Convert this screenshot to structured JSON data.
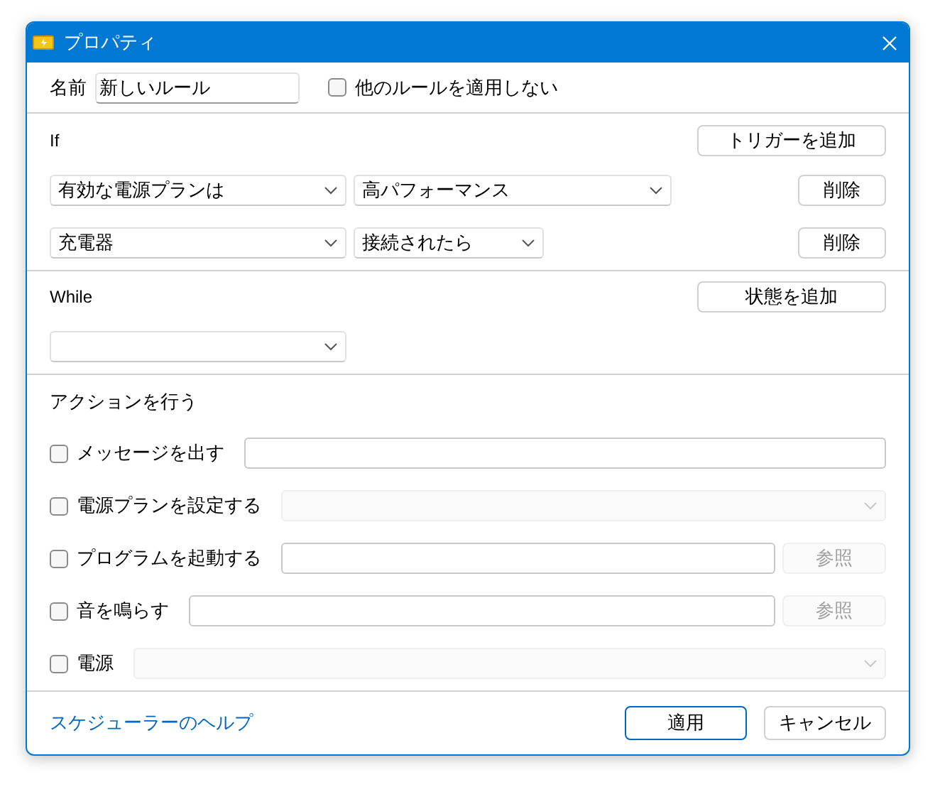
{
  "window": {
    "title": "プロパティ"
  },
  "name": {
    "label": "名前",
    "value": "新しいルール"
  },
  "exclusive": {
    "label": "他のルールを適用しない",
    "checked": false
  },
  "if": {
    "label": "If",
    "add_button": "トリガーを追加",
    "triggers": [
      {
        "kind": "wide",
        "condition": "有効な電源プランは",
        "value": "高パフォーマンス",
        "delete_button": "削除"
      },
      {
        "kind": "narrow",
        "condition": "充電器",
        "value": "接続されたら",
        "delete_button": "削除"
      }
    ]
  },
  "while": {
    "label": "While",
    "add_button": "状態を追加"
  },
  "actions": {
    "label": "アクションを行う",
    "items": [
      {
        "kind": "text",
        "label": "メッセージを出す",
        "checked": false,
        "disabled": false
      },
      {
        "kind": "select",
        "label": "電源プランを設定する",
        "checked": false,
        "disabled": true
      },
      {
        "kind": "file",
        "label": "プログラムを起動する",
        "checked": false,
        "disabled": false,
        "browse_button": {
          "label": "参照",
          "disabled": true
        }
      },
      {
        "kind": "file",
        "label": "音を鳴らす",
        "checked": false,
        "disabled": false,
        "browse_button": {
          "label": "参照",
          "disabled": true
        }
      },
      {
        "kind": "select",
        "label": "電源",
        "checked": false,
        "disabled": true
      }
    ]
  },
  "footer": {
    "help_link": "スケジューラーのヘルプ",
    "buttons": [
      {
        "label": "適用",
        "default": true
      },
      {
        "label": "キャンセル",
        "default": false
      }
    ]
  }
}
